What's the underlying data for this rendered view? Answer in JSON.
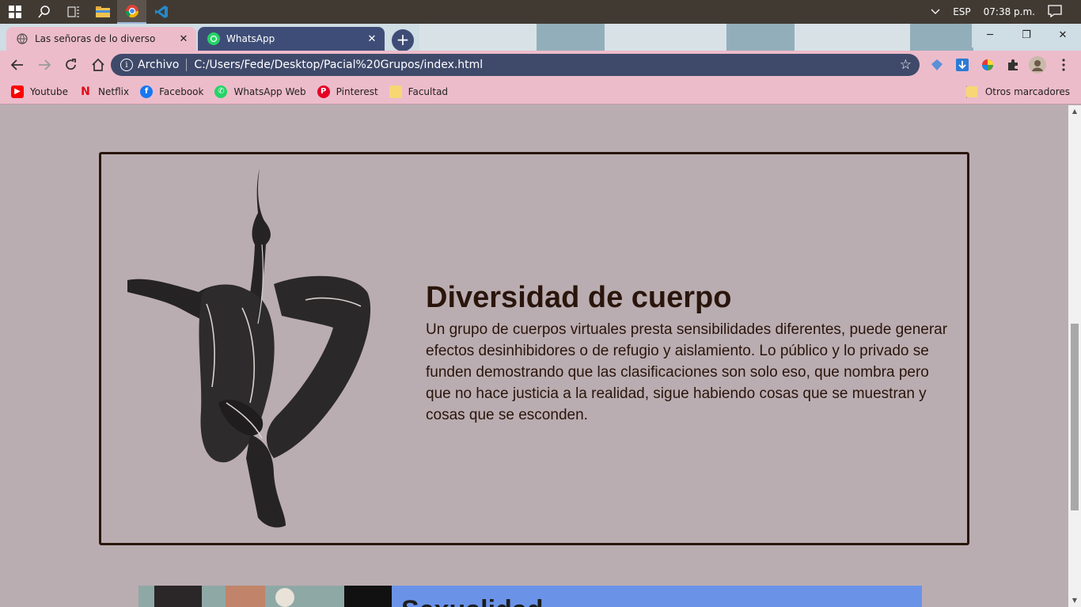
{
  "taskbar": {
    "icons": [
      "windows-start-icon",
      "search-icon",
      "task-view-icon",
      "file-explorer-icon",
      "chrome-icon",
      "vscode-icon"
    ],
    "language": "ESP",
    "clock": "07:38 p.m."
  },
  "browser": {
    "tabs": [
      {
        "title": "Las señoras de lo diverso"
      },
      {
        "title": "WhatsApp"
      }
    ],
    "address": {
      "scheme_label": "Archivo",
      "url": "C:/Users/Fede/Desktop/Pacial%20Grupos/index.html"
    },
    "bookmarks": [
      {
        "label": "Youtube",
        "color": "#ff0000"
      },
      {
        "label": "Netflix",
        "color": "#e50914"
      },
      {
        "label": "Facebook",
        "color": "#1877f2"
      },
      {
        "label": "WhatsApp Web",
        "color": "#25d366"
      },
      {
        "label": "Pinterest",
        "color": "#e60023"
      },
      {
        "label": "Facultad",
        "color": "#f7d774"
      }
    ],
    "other_bookmarks": "Otros marcadores",
    "accent_color": "#edbccb"
  },
  "page": {
    "section": {
      "heading": "Diversidad de cuerpo",
      "body": "Un grupo de cuerpos virtuales presta sensibilidades diferentes, puede generar efectos desinhibidores o de refugio y aislamiento. Lo público y lo privado se funden demostrando que las clasificaciones son solo eso, que nombra pero que no hace justicia a la realidad, sigue habiendo cosas que se muestran y cosas que se esconden."
    },
    "next_section_heading": "Sexualidad",
    "background_color": "#baadb1",
    "text_color": "#2a150c"
  }
}
